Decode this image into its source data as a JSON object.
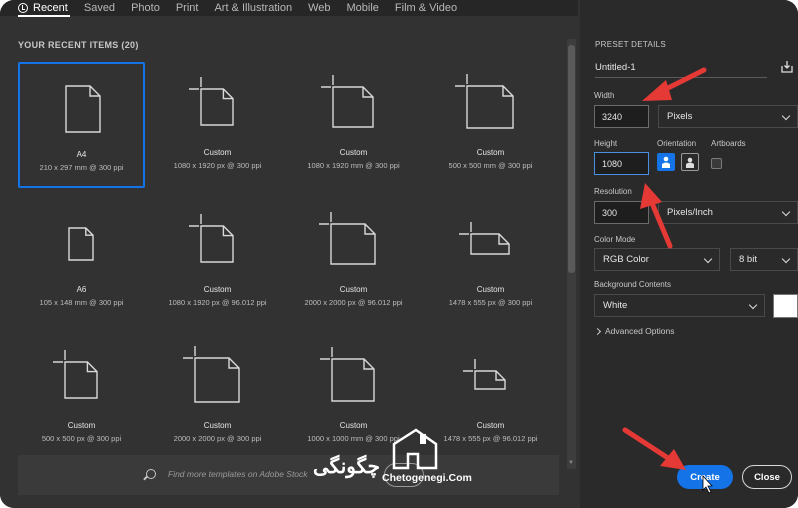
{
  "tabs": [
    {
      "label": "Recent",
      "active": true
    },
    {
      "label": "Saved"
    },
    {
      "label": "Photo"
    },
    {
      "label": "Print"
    },
    {
      "label": "Art & Illustration"
    },
    {
      "label": "Web"
    },
    {
      "label": "Mobile"
    },
    {
      "label": "Film & Video"
    }
  ],
  "recent": {
    "title": "YOUR RECENT ITEMS",
    "count": "(20)",
    "items": [
      {
        "name": "A4",
        "size": "210 x 297 mm @ 300 ppi",
        "selected": true
      },
      {
        "name": "Custom",
        "size": "1080 x 1920 px @ 300 ppi"
      },
      {
        "name": "Custom",
        "size": "1080 x 1920 mm @ 300 ppi"
      },
      {
        "name": "Custom",
        "size": "500 x 500 mm @ 300 ppi"
      },
      {
        "name": "A6",
        "size": "105 x 148 mm @ 300 ppi"
      },
      {
        "name": "Custom",
        "size": "1080 x 1920 px @ 96.012 ppi"
      },
      {
        "name": "Custom",
        "size": "2000 x 2000 px @ 96.012 ppi"
      },
      {
        "name": "Custom",
        "size": "1478 x 555 px @ 300 ppi"
      },
      {
        "name": "Custom",
        "size": "500 x 500 px @ 300 ppi"
      },
      {
        "name": "Custom",
        "size": "2000 x 2000 px @ 300 ppi"
      },
      {
        "name": "Custom",
        "size": "1000 x 1000 mm @ 300 ppi"
      },
      {
        "name": "Custom",
        "size": "1478 x 555 px @ 96.012 ppi"
      }
    ]
  },
  "search": {
    "placeholder": "Find more templates on Adobe Stock"
  },
  "preset": {
    "title": "PRESET DETAILS",
    "doc_name": "Untitled-1",
    "width_label": "Width",
    "width_value": "3240",
    "width_unit": "Pixels",
    "height_label": "Height",
    "height_value": "1080",
    "orientation_label": "Orientation",
    "artboards_label": "Artboards",
    "resolution_label": "Resolution",
    "resolution_value": "300",
    "resolution_unit": "Pixels/Inch",
    "color_mode_label": "Color Mode",
    "color_mode": "RGB Color",
    "bit_depth": "8 bit",
    "background_label": "Background Contents",
    "background": "White",
    "advanced": "Advanced Options",
    "create": "Create",
    "close": "Close"
  },
  "watermark": {
    "text": "Chetogenegi.Com",
    "fa": "چگونگی"
  },
  "colors": {
    "accent": "#1473e6",
    "arrow": "#e53935"
  }
}
